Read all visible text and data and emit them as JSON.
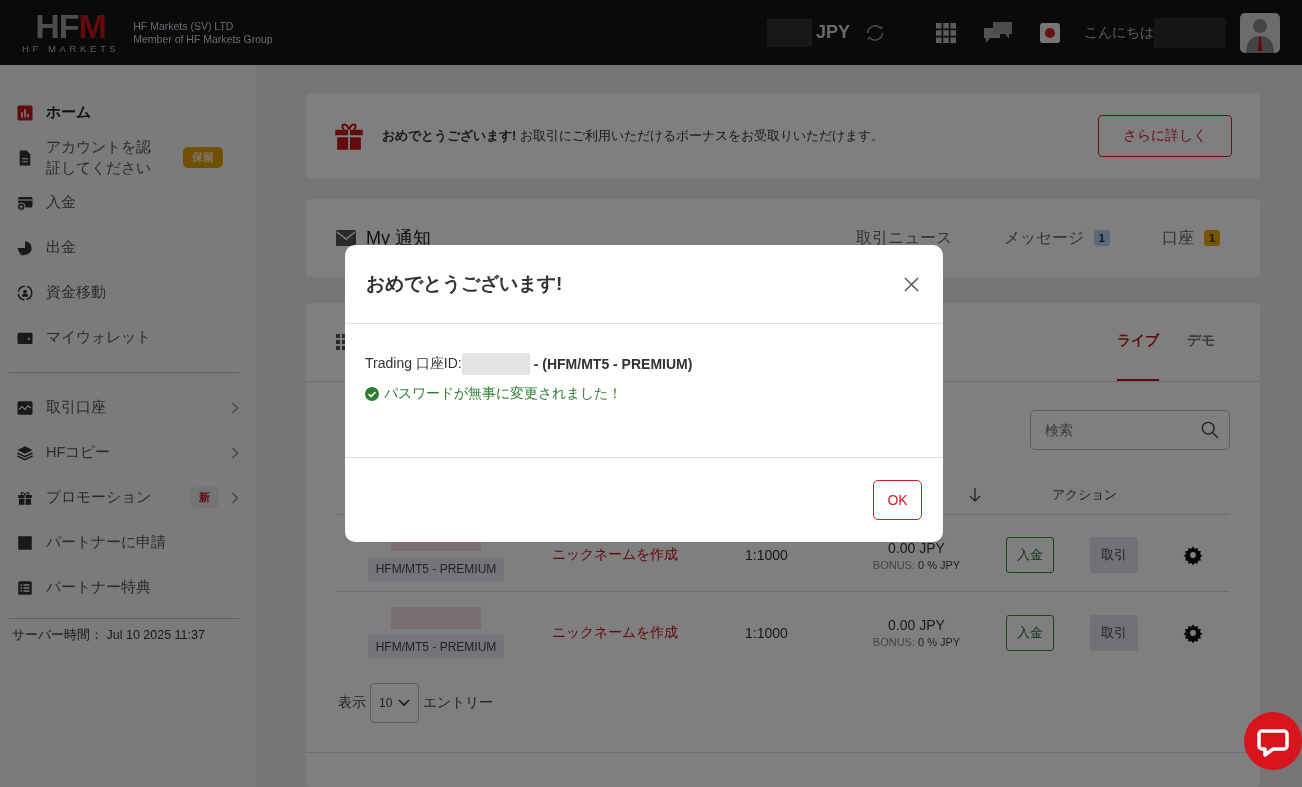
{
  "header": {
    "logo": "HFM",
    "logo_subtitle": "HF MARKETS",
    "company_lines": [
      "HF Markets (SV) LTD",
      "Member of HF Markets Group"
    ],
    "currency": "JPY",
    "greeting": "こんにちは"
  },
  "sidebar": {
    "groups": [
      {
        "items": [
          {
            "label": "ホーム",
            "selected": true,
            "expandable": false
          },
          {
            "label": "アカウントを認証してください",
            "selected": false,
            "expandable": false,
            "badge": {
              "text": "保留",
              "color": "#705000"
            }
          },
          {
            "label": "入金",
            "selected": false,
            "expandable": false
          },
          {
            "label": "出金",
            "selected": false,
            "expandable": false
          },
          {
            "label": "資金移動",
            "selected": false,
            "expandable": false
          },
          {
            "label": "マイウォレット",
            "selected": false,
            "expandable": false
          }
        ]
      },
      {
        "items": [
          {
            "label": "取引口座",
            "selected": false,
            "expandable": true
          },
          {
            "label": "HFコピー",
            "selected": false,
            "expandable": true
          },
          {
            "label": "プロモーション",
            "selected": false,
            "expandable": true,
            "badge": {
              "text": "新",
              "color": "#737476"
            }
          },
          {
            "label": "パートナーに申請",
            "selected": false,
            "expandable": false
          },
          {
            "label": "パートナー特典",
            "selected": false,
            "expandable": false
          }
        ]
      }
    ],
    "server_time": "サーバー時間： Jul 10 2025 11:37"
  },
  "bonus_banner": {
    "text": "**おめでとうございます!**  お取引にご利用いただけるボーナスをお受取りいただけます。",
    "button": "さらに詳しく"
  },
  "notifications": {
    "title": "My 通知",
    "tabs": [
      {
        "label": "取引ニュース"
      },
      {
        "label": "メッセージ",
        "count": {
          "text": "1",
          "color": "#5c6978"
        }
      },
      {
        "label": "口座",
        "count": {
          "text": "1",
          "color": "#785400"
        }
      }
    ]
  },
  "accounts": {
    "tabs": [
      {
        "label": "ライブ",
        "selected": true
      },
      {
        "label": "デモ",
        "selected": false
      }
    ],
    "search": {
      "placeholder": "検索"
    },
    "columns": [
      {
        "label": "アクション"
      }
    ],
    "rows": [
      {
        "platform": "HFM/MT5 - PREMIUM",
        "nickname": "ニックネームを作成",
        "leverage": "1:1000",
        "balance": "0.00 JPY",
        "bonus_label": "BONUS:",
        "bonus": "0 % JPY",
        "deposit": "入金",
        "trade": "取引"
      },
      {
        "platform": "HFM/MT5 - PREMIUM",
        "nickname": "ニックネームを作成",
        "leverage": "1:1000",
        "balance": "0.00 JPY",
        "bonus_label": "BONUS:",
        "bonus": "0 % JPY",
        "deposit": "入金",
        "trade": "取引"
      }
    ],
    "page_size": {
      "label_before": "表示",
      "value": "10",
      "label_after": "エントリー"
    }
  },
  "modal": {
    "title": "おめでとうございます!",
    "account_label": "Trading 口座ID:",
    "account_suffix": "- (HFM/MT5 - PREMIUM)",
    "success": "パスワードが無事に変更されました！",
    "ok": "OK"
  }
}
